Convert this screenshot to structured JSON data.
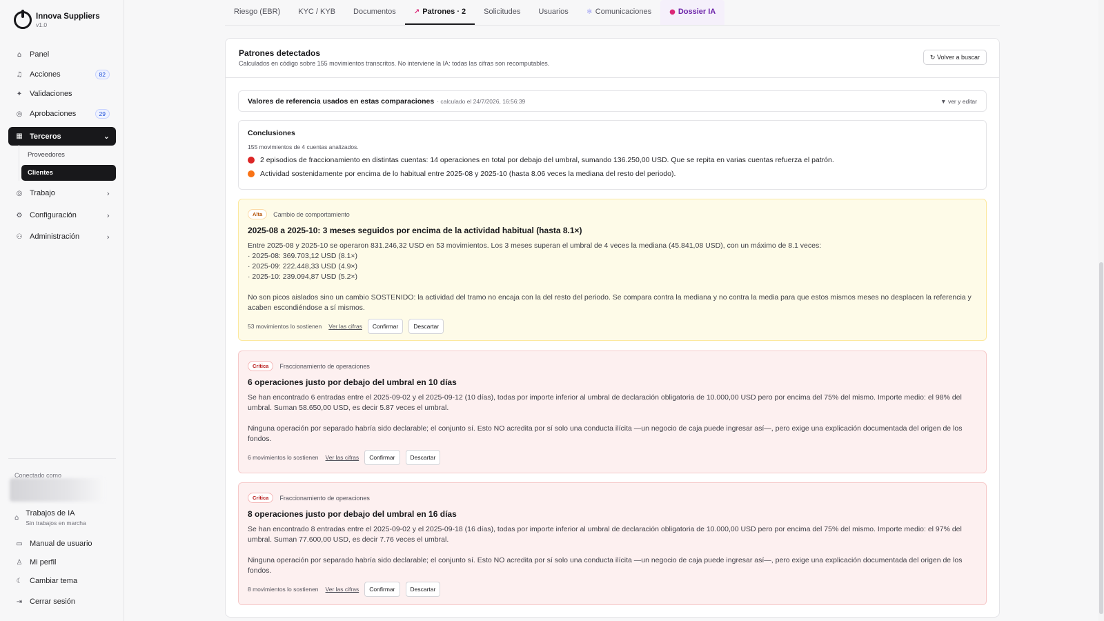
{
  "brand": {
    "name": "Innova Suppliers",
    "version": "v1.0"
  },
  "sidebar": {
    "items": [
      {
        "label": "Panel",
        "icon": "home-icon"
      },
      {
        "label": "Acciones",
        "icon": "bell-icon",
        "badge": "82"
      },
      {
        "label": "Validaciones",
        "icon": "sparkle-icon"
      },
      {
        "label": "Aprobaciones",
        "icon": "check-circle-icon",
        "badge": "29"
      },
      {
        "label": "Terceros",
        "icon": "building-icon",
        "active": true
      },
      {
        "label": "Trabajo",
        "icon": "check-circle-icon"
      },
      {
        "label": "Configuración",
        "icon": "gear-icon"
      },
      {
        "label": "Administración",
        "icon": "users-icon"
      }
    ],
    "subitems": [
      {
        "label": "Proveedores"
      },
      {
        "label": "Clientes",
        "active": true
      }
    ],
    "connected_label": "Conectado como",
    "ai_jobs": {
      "title": "Trabajos de IA",
      "status": "Sin trabajos en marcha"
    },
    "bottom": [
      {
        "label": "Manual de usuario",
        "icon": "book-icon"
      },
      {
        "label": "Mi perfil",
        "icon": "user-icon"
      },
      {
        "label": "Cambiar tema",
        "icon": "moon-icon"
      },
      {
        "label": "Cerrar sesión",
        "icon": "logout-icon"
      }
    ]
  },
  "tabs": [
    {
      "label": "Riesgo (EBR)"
    },
    {
      "label": "KYC / KYB"
    },
    {
      "label": "Documentos"
    },
    {
      "label": "Patrones · 2",
      "icon": "chart-icon",
      "active": true
    },
    {
      "label": "Solicitudes"
    },
    {
      "label": "Usuarios"
    },
    {
      "label": "Comunicaciones",
      "icon": "atom-icon"
    },
    {
      "label": "Dossier IA",
      "icon": "brain-icon"
    }
  ],
  "card": {
    "title": "Patrones detectados",
    "subtitle": "Calculados en código sobre 155 movimientos transcritos. No interviene la IA: todas las cifras son recomputables.",
    "search_button": "↻ Volver a buscar"
  },
  "reference": {
    "title": "Valores de referencia usados en estas comparaciones",
    "meta": "· calculado el 24/7/2026, 16:56:39",
    "toggle": "▼ ver y editar"
  },
  "conclusions": {
    "title": "Conclusiones",
    "subtitle": "155 movimientos de 4 cuentas analizados.",
    "items": [
      {
        "text": "2 episodios de fraccionamiento en distintas cuentas: 14 operaciones en total por debajo del umbral, sumando 136.250,00 USD. Que se repita en varias cuentas refuerza el patrón.",
        "color": "#dc2626"
      },
      {
        "text": "Actividad sostenidamente por encima de lo habitual entre 2025-08 y 2025-10 (hasta 8.06 veces la mediana del resto del periodo).",
        "color": "#f97316"
      }
    ]
  },
  "findings": [
    {
      "severity": "Alta",
      "type": "Cambio de comportamiento",
      "title": "2025-08 a 2025-10: 3 meses seguidos por encima de la actividad habitual (hasta 8.1×)",
      "lines": [
        "Entre 2025-08 y 2025-10 se operaron 831.246,32 USD en 53 movimientos. Los 3 meses superan el umbral de 4 veces la mediana (45.841,08 USD), con un máximo de 8.1 veces:",
        "· 2025-08: 369.703,12 USD (8.1×)",
        "· 2025-09: 222.448,33 USD (4.9×)",
        "· 2025-10: 239.094,87 USD (5.2×)"
      ],
      "paragraph": "No son picos aislados sino un cambio SOSTENIDO: la actividad del tramo no encaja con la del resto del periodo. Se compara contra la mediana y no contra la media para que estos mismos meses no desplacen la referencia y acaben escondiéndose a sí mismos.",
      "support": "53 movimientos lo sostienen",
      "link": "Ver las cifras",
      "confirm": "Confirmar",
      "dismiss": "Descartar"
    },
    {
      "severity": "Crítica",
      "type": "Fraccionamiento de operaciones",
      "title": "6 operaciones justo por debajo del umbral en 10 días",
      "lines": [
        "Se han encontrado 6 entradas entre el 2025-09-02 y el 2025-09-12 (10 días), todas por importe inferior al umbral de declaración obligatoria de 10.000,00 USD pero por encima del 75% del mismo. Importe medio: el 98% del umbral. Suman 58.650,00 USD, es decir 5.87 veces el umbral."
      ],
      "paragraph": "Ninguna operación por separado habría sido declarable; el conjunto sí. Esto NO acredita por sí solo una conducta ilícita —un negocio de caja puede ingresar así—, pero exige una explicación documentada del origen de los fondos.",
      "support": "6 movimientos lo sostienen",
      "link": "Ver las cifras",
      "confirm": "Confirmar",
      "dismiss": "Descartar"
    },
    {
      "severity": "Crítica",
      "type": "Fraccionamiento de operaciones",
      "title": "8 operaciones justo por debajo del umbral en 16 días",
      "lines": [
        "Se han encontrado 8 entradas entre el 2025-09-02 y el 2025-09-18 (16 días), todas por importe inferior al umbral de declaración obligatoria de 10.000,00 USD pero por encima del 75% del mismo. Importe medio: el 97% del umbral. Suman 77.600,00 USD, es decir 7.76 veces el umbral."
      ],
      "paragraph": "Ninguna operación por separado habría sido declarable; el conjunto sí. Esto NO acredita por sí solo una conducta ilícita —un negocio de caja puede ingresar así—, pero exige una explicación documentada del origen de los fondos.",
      "support": "8 movimientos lo sostienen",
      "link": "Ver las cifras",
      "confirm": "Confirmar",
      "dismiss": "Descartar"
    }
  ]
}
